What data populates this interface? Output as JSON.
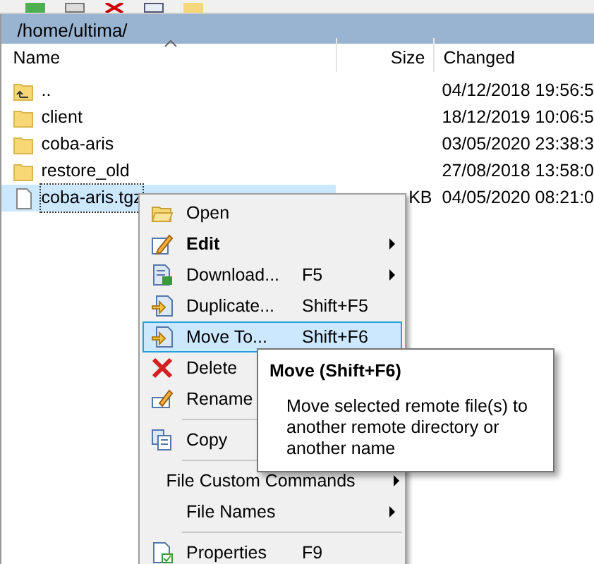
{
  "path": "/home/ultima/",
  "columns": [
    {
      "label": "Name",
      "sorted": true
    },
    {
      "label": "Size",
      "sorted": false
    },
    {
      "label": "Changed",
      "sorted": false
    }
  ],
  "rows": [
    {
      "kind": "parent",
      "name": "..",
      "changed": "04/12/2018 19:56:5",
      "selected": false
    },
    {
      "kind": "folder",
      "name": "client",
      "changed": "18/12/2019 10:06:5",
      "selected": false
    },
    {
      "kind": "folder",
      "name": "coba-aris",
      "changed": "03/05/2020 23:38:3",
      "selected": false
    },
    {
      "kind": "folder",
      "name": "restore_old",
      "changed": "27/08/2018 13:58:0",
      "selected": false
    },
    {
      "kind": "file",
      "name": "coba-aris.tgz",
      "size": "KB",
      "changed": "04/05/2020 08:21:0",
      "selected": true
    }
  ],
  "menu": [
    {
      "kind": "item",
      "label": "Open",
      "bold": false,
      "selected": false
    },
    {
      "kind": "item",
      "label": "Edit",
      "bold": true,
      "submenu": true,
      "selected": false
    },
    {
      "kind": "item",
      "label": "Download...",
      "shortcut": "F5",
      "bold": false,
      "submenu": true,
      "selected": false
    },
    {
      "kind": "item",
      "label": "Duplicate...",
      "shortcut": "Shift+F5",
      "bold": false,
      "selected": false
    },
    {
      "kind": "item",
      "label": "Move To...",
      "shortcut": "Shift+F6",
      "bold": false,
      "selected": true
    },
    {
      "kind": "item",
      "label": "Delete",
      "bold": false,
      "selected": false
    },
    {
      "kind": "item",
      "label": "Rename",
      "bold": false,
      "selected": false
    },
    {
      "kind": "separator"
    },
    {
      "kind": "item",
      "label": "Copy",
      "bold": false,
      "selected": false
    },
    {
      "kind": "separator"
    },
    {
      "kind": "item",
      "label": "File Custom Commands",
      "bold": false,
      "submenu": true,
      "selected": false
    },
    {
      "kind": "item",
      "label": "File Names",
      "bold": false,
      "submenu": true,
      "selected": false
    },
    {
      "kind": "separator"
    },
    {
      "kind": "item",
      "label": "Properties",
      "shortcut": "F9",
      "bold": false,
      "selected": false
    }
  ],
  "tooltip": {
    "title": "Move (Shift+F6)",
    "text": "Move selected remote file(s) to another remote directory or another name"
  }
}
